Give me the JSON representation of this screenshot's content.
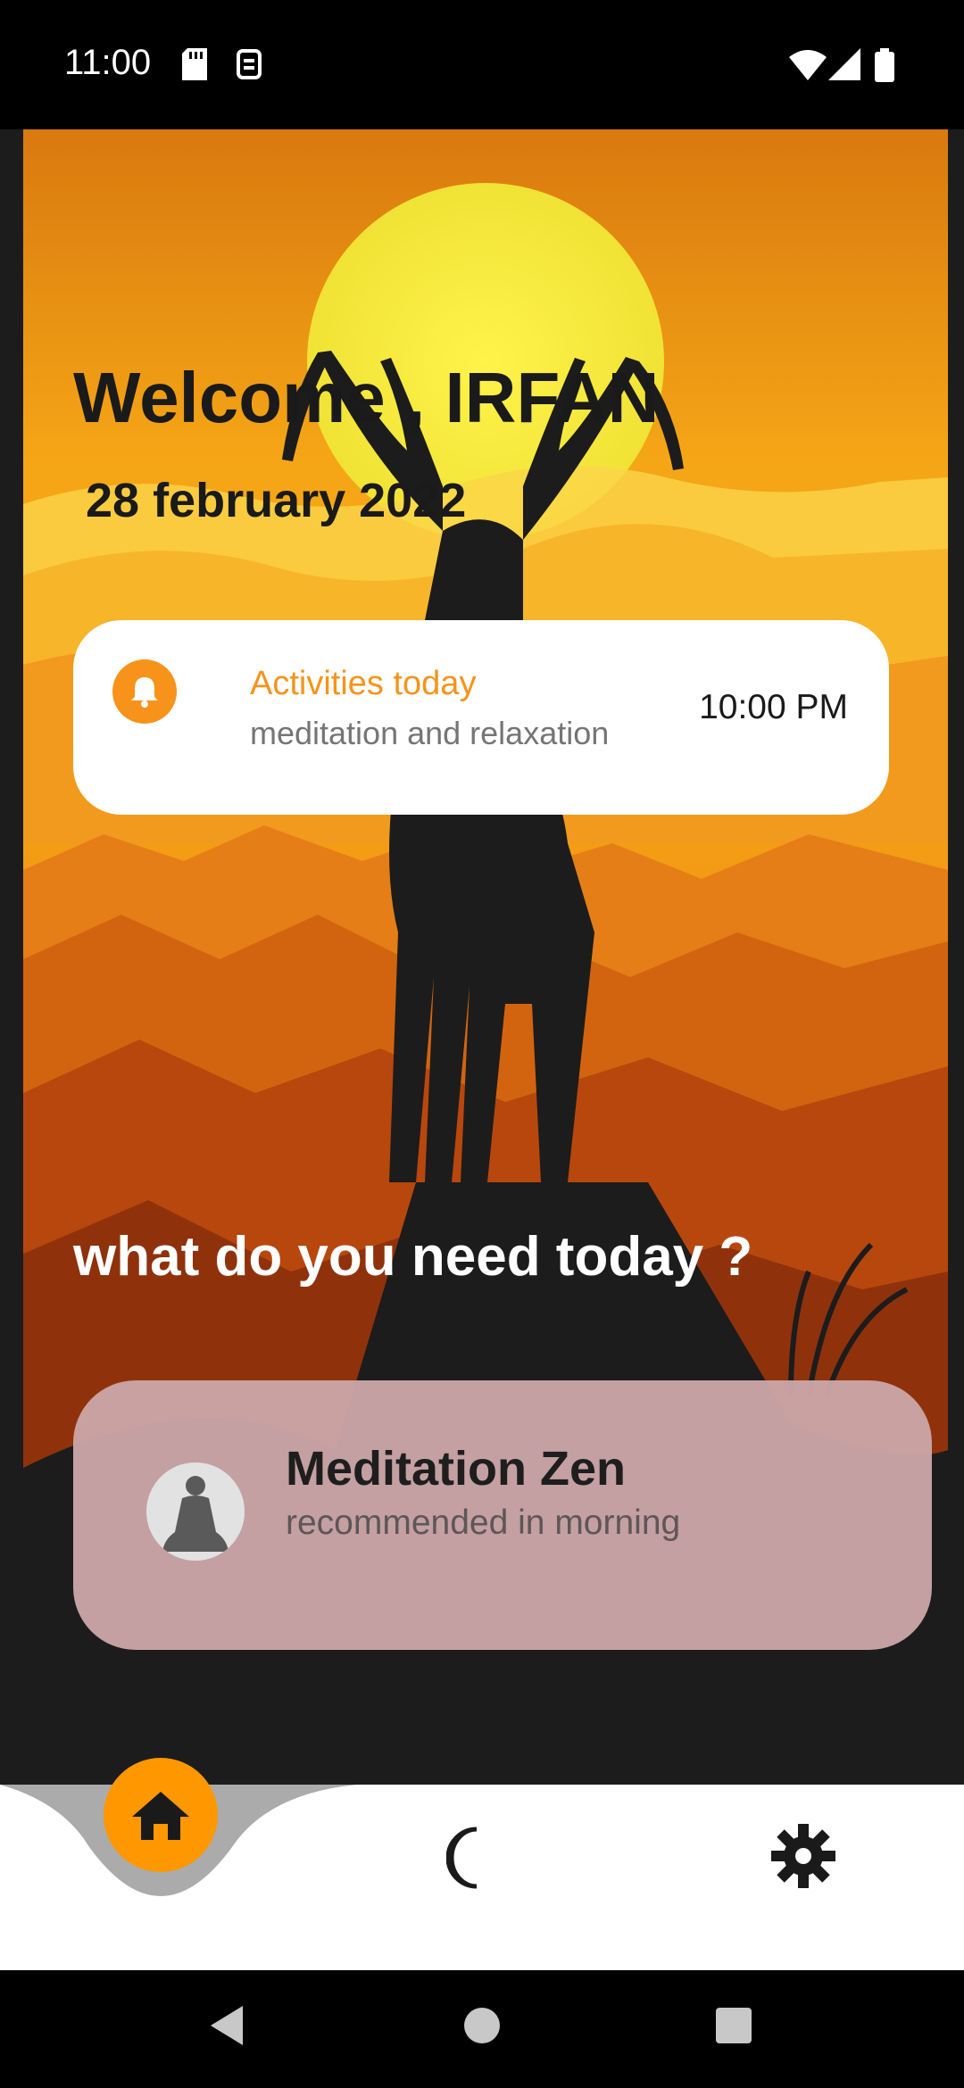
{
  "status_bar": {
    "time": "11:00",
    "icons": [
      "sd-card-icon",
      "sim-icon",
      "wifi-icon",
      "signal-icon",
      "battery-icon"
    ]
  },
  "header": {
    "welcome": "Welcome , IRFAN",
    "date": "28 february  2022"
  },
  "activity_card": {
    "icon": "bell-icon",
    "title": "Activities today",
    "subtitle": "meditation and relaxation",
    "time": "10:00 PM"
  },
  "prompt": "what do you need  today ?",
  "recommendation": {
    "icon": "meditation-avatar",
    "title": "Meditation Zen",
    "subtitle": "recommended in morning"
  },
  "bottom_nav": {
    "items": [
      "home-icon",
      "moon-icon",
      "gear-icon"
    ],
    "active": "home-icon"
  },
  "colors": {
    "accent": "#ff9700",
    "card_pink": "#cba5a8",
    "sky_orange": "#f5a216"
  }
}
